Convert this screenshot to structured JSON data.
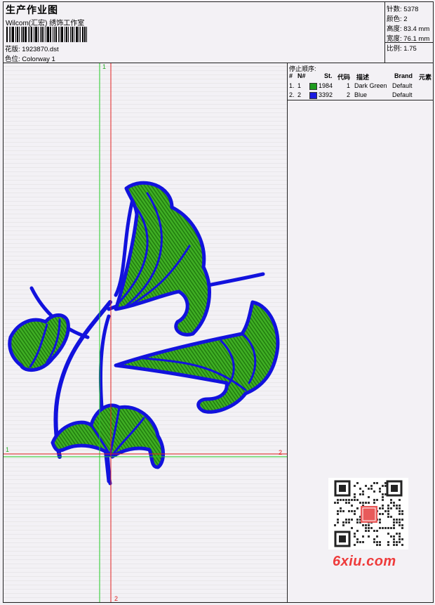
{
  "header": {
    "title": "生产作业图",
    "company": "Wilcom(汇宏) 绣饰工作室",
    "design_label": "花版:",
    "design_value": "1923870.dst",
    "colorway_label": "色位:",
    "colorway_value": "Colorway 1"
  },
  "stats": [
    {
      "label": "针数:",
      "value": "5378"
    },
    {
      "label": "颜色:",
      "value": "2"
    },
    {
      "label": "高度:",
      "value": "83.4 mm"
    },
    {
      "label": "宽度:",
      "value": "76.1 mm"
    },
    {
      "label": "比例:",
      "value": "1.75"
    }
  ],
  "stop_sequence": {
    "title": "停止顺序:",
    "columns": [
      "#",
      "N#",
      "St.",
      "代码",
      "描述",
      "Brand",
      "元素"
    ],
    "rows": [
      {
        "index": "1.",
        "n": "1",
        "stitches": "1984",
        "code": "1",
        "description": "Dark Green",
        "brand": "Default",
        "color": "#1d9a1d"
      },
      {
        "index": "2.",
        "n": "2",
        "stitches": "3392",
        "code": "2",
        "description": "Blue",
        "brand": "Default",
        "color": "#1a1adf"
      }
    ]
  },
  "guides": {
    "vertical_top_label": "1",
    "vertical_bottom_label": "2",
    "horizontal_left_label": "1",
    "horizontal_right_label": "2"
  },
  "colors": {
    "green_thread": "#2a9a16",
    "blue_thread": "#1212dd",
    "guide_green": "#22cc22",
    "guide_red": "#e02020"
  },
  "watermark": {
    "text": "6xiu.com"
  }
}
